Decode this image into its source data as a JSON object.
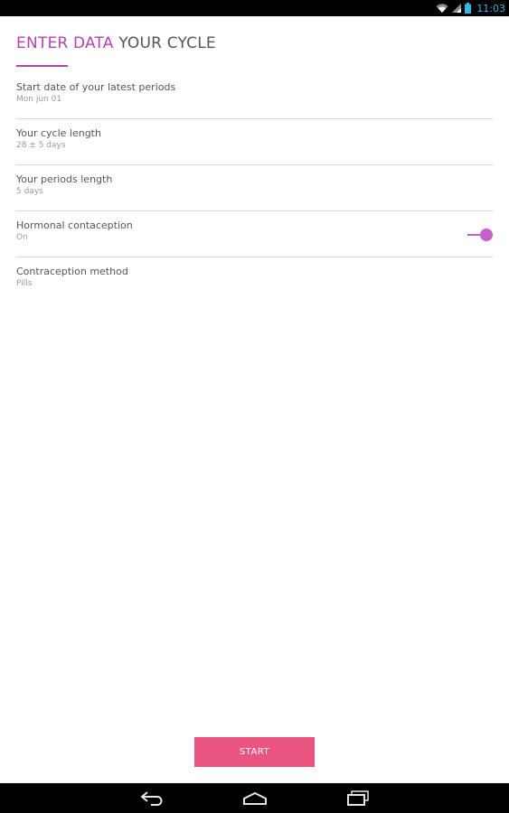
{
  "status_bar": {
    "time": "11:03",
    "icons": [
      "wifi-icon",
      "signal-icon",
      "battery-icon"
    ]
  },
  "header": {
    "title_accent": "ENTER DATA",
    "title_rest": " YOUR CYCLE",
    "accent_color": "#b542b3"
  },
  "settings": [
    {
      "label": "Start date of your latest periods",
      "value": "Mon jun 01"
    },
    {
      "label": "Your cycle length",
      "value": "28 ± 5 days"
    },
    {
      "label": "Your periods length",
      "value": "5 days"
    },
    {
      "label": "Hormonal contaception",
      "value": "On",
      "toggle_on": true
    },
    {
      "label": "Contraception method",
      "value": "Pills"
    }
  ],
  "start_button": {
    "label": "START",
    "color": "#ea5481"
  },
  "nav_bar": {
    "icons": [
      "back-icon",
      "home-icon",
      "recent-apps-icon"
    ]
  }
}
